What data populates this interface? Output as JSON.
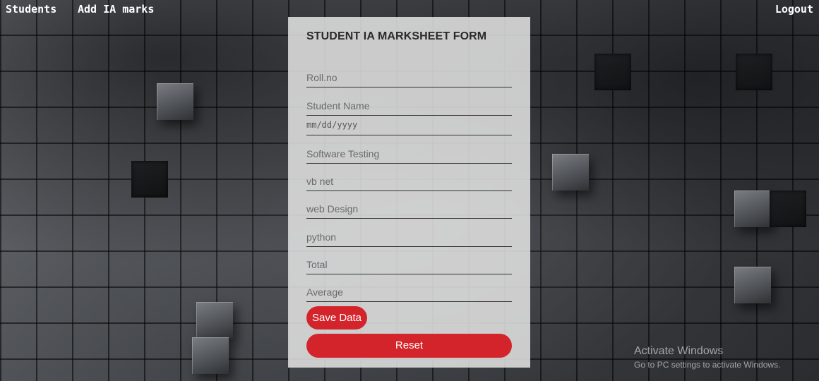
{
  "nav": {
    "students": "Students",
    "add_ia_marks": "Add IA marks",
    "logout": "Logout"
  },
  "form": {
    "title": "STUDENT IA MARKSHEET FORM",
    "fields": {
      "roll_no": {
        "placeholder": "Roll.no",
        "value": ""
      },
      "student_name": {
        "placeholder": "Student Name",
        "value": ""
      },
      "date": {
        "placeholder": "mm/dd/yyyy",
        "value": ""
      },
      "software_testing": {
        "placeholder": "Software Testing",
        "value": ""
      },
      "vb_net": {
        "placeholder": "vb net",
        "value": ""
      },
      "web_design": {
        "placeholder": "web Design",
        "value": ""
      },
      "python": {
        "placeholder": "python",
        "value": ""
      },
      "total": {
        "placeholder": "Total",
        "value": ""
      },
      "average": {
        "placeholder": "Average",
        "value": ""
      }
    },
    "save_label": "Save Data",
    "reset_label": "Reset"
  },
  "watermark": {
    "title": "Activate Windows",
    "subtitle": "Go to PC settings to activate Windows."
  },
  "colors": {
    "accent": "#d4242b",
    "panel": "#e4e4e4",
    "nav_text": "#ffffff"
  }
}
